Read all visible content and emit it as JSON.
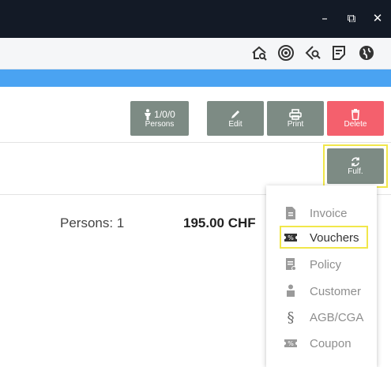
{
  "window": {
    "minimize_glyph": "–",
    "maximize_glyph": "⧉",
    "close_glyph": "✕"
  },
  "toolbar": {
    "icons": [
      "home-search-icon",
      "target-icon",
      "bookmark-search-icon",
      "notes-icon",
      "globe-icon"
    ]
  },
  "actions": {
    "persons_count": "1/0/0",
    "persons_label": "Persons",
    "edit_label": "Edit",
    "print_label": "Print",
    "delete_label": "Delete",
    "fulfill_label": "Fulf."
  },
  "summary": {
    "persons_text": "Persons: 1",
    "total": "195.00 CHF"
  },
  "menu": {
    "items": [
      {
        "label": "Invoice",
        "icon": "file-icon"
      },
      {
        "label": "Vouchers",
        "icon": "ticket-icon",
        "highlighted": true
      },
      {
        "label": "Policy",
        "icon": "document-icon"
      },
      {
        "label": "Customer",
        "icon": "person-icon"
      },
      {
        "label": "AGB/CGA",
        "icon": "paragraph-icon"
      },
      {
        "label": "Coupon",
        "icon": "coupon-icon"
      }
    ]
  },
  "colors": {
    "titlebar": "#131a26",
    "accent_blue": "#4aa3f2",
    "button_gray": "#7d8b84",
    "button_red": "#f4606d",
    "highlight": "#f1e74a"
  }
}
